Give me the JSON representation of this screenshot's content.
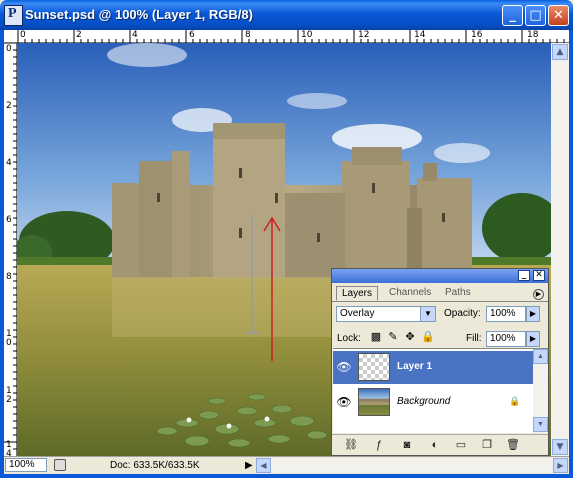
{
  "window": {
    "title": "Sunset.psd @ 100% (Layer 1, RGB/8)",
    "app_icon_letter": "P",
    "buttons": {
      "minimize": "_",
      "maximize": "□",
      "close": "✕"
    },
    "titlebar_color": "#0a58d8"
  },
  "rulers": {
    "top_labels": [
      "0",
      "2",
      "4",
      "6",
      "8",
      "10",
      "12",
      "14",
      "16",
      "18"
    ],
    "left_labels": [
      "0",
      "2",
      "4",
      "6",
      "8",
      "1\n0",
      "1\n2",
      "1\n4"
    ]
  },
  "status": {
    "zoom": "100%",
    "doc": "Doc: 633.5K/633.5K",
    "menu_arrow": "▶"
  },
  "layers_panel": {
    "tabs": [
      "Layers",
      "Channels",
      "Paths"
    ],
    "active_tab": "Layers",
    "blend_mode": "Overlay",
    "opacity_label": "Opacity:",
    "opacity_value": "100%",
    "lock_label": "Lock:",
    "fill_label": "Fill:",
    "fill_value": "100%",
    "layers": [
      {
        "name": "Layer 1",
        "selected": true,
        "visible": true,
        "thumbnail": "transparent"
      },
      {
        "name": "Background",
        "selected": false,
        "visible": true,
        "thumbnail": "castle-image",
        "locked": true
      }
    ],
    "selected_color": "#4a73c4"
  },
  "canvas": {
    "image": "castle-in-lake-photo",
    "annotation_arrow_color": "#d02020"
  }
}
